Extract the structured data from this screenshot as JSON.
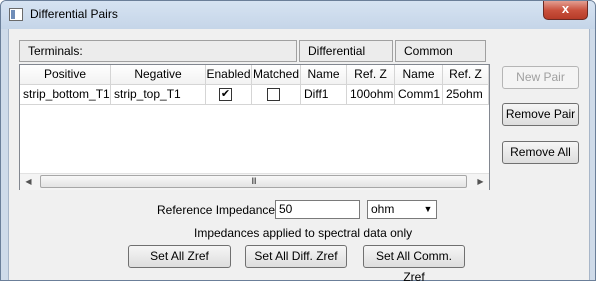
{
  "window": {
    "title": "Differential Pairs",
    "close_glyph": "x"
  },
  "headers": {
    "terminals": "Terminals:",
    "differential_mode": "Differential Mode:",
    "common_mode": "Common Mode:"
  },
  "columns": [
    "Positive",
    "Negative",
    "Enabled",
    "Matched",
    "Name",
    "Ref. Z",
    "Name",
    "Ref. Z"
  ],
  "rows": [
    {
      "positive": "strip_bottom_T1",
      "negative": "strip_top_T1",
      "enabled": true,
      "matched": false,
      "diff_name": "Diff1",
      "diff_refz": "100ohm",
      "comm_name": "Comm1",
      "comm_refz": "25ohm"
    }
  ],
  "check_glyph": "✔",
  "scrollbar": {
    "left_arrow": "◀",
    "right_arrow": "▶",
    "grip": "III"
  },
  "buttons": {
    "new_pair": "New Pair",
    "remove_pair": "Remove Pair",
    "remove_all": "Remove All",
    "set_all_zref": "Set All Zref",
    "set_all_diff_zref": "Set All Diff. Zref",
    "set_all_comm_zref": "Set All Comm. Zref"
  },
  "reference_impedance": {
    "label": "Reference Impedance:",
    "value": "50",
    "unit": "ohm",
    "dropdown_glyph": "▼"
  },
  "note": "Impedances applied to spectral data only"
}
